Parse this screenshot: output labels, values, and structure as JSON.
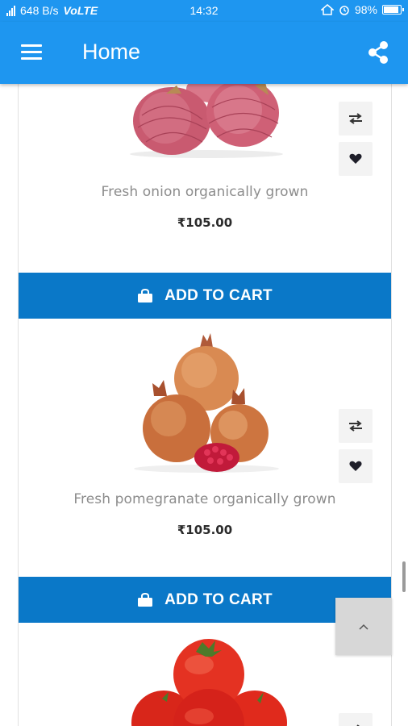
{
  "status_bar": {
    "speed": "648 B/s",
    "network": "VoLTE",
    "time": "14:32",
    "battery": "98%"
  },
  "app_bar": {
    "title": "Home",
    "menu_icon": "hamburger-menu-icon",
    "share_icon": "share-icon"
  },
  "products": [
    {
      "name": "Fresh onion organically grown",
      "price": "₹105.00",
      "image": "onion-image",
      "cart_label": "ADD TO CART"
    },
    {
      "name": "Fresh pomegranate organically grown",
      "price": "₹105.00",
      "image": "pomegranate-image",
      "cart_label": "ADD TO CART"
    },
    {
      "name": "",
      "price": "",
      "image": "tomato-image",
      "cart_label": ""
    }
  ],
  "icons": {
    "compare": "swap-arrows-icon",
    "wishlist": "heart-icon",
    "cart": "shopping-bag-icon",
    "scroll_top": "chevron-up-icon"
  },
  "colors": {
    "primary": "#1e96f0",
    "cart_button": "#0a78c8",
    "product_name": "#8c8c8c"
  }
}
